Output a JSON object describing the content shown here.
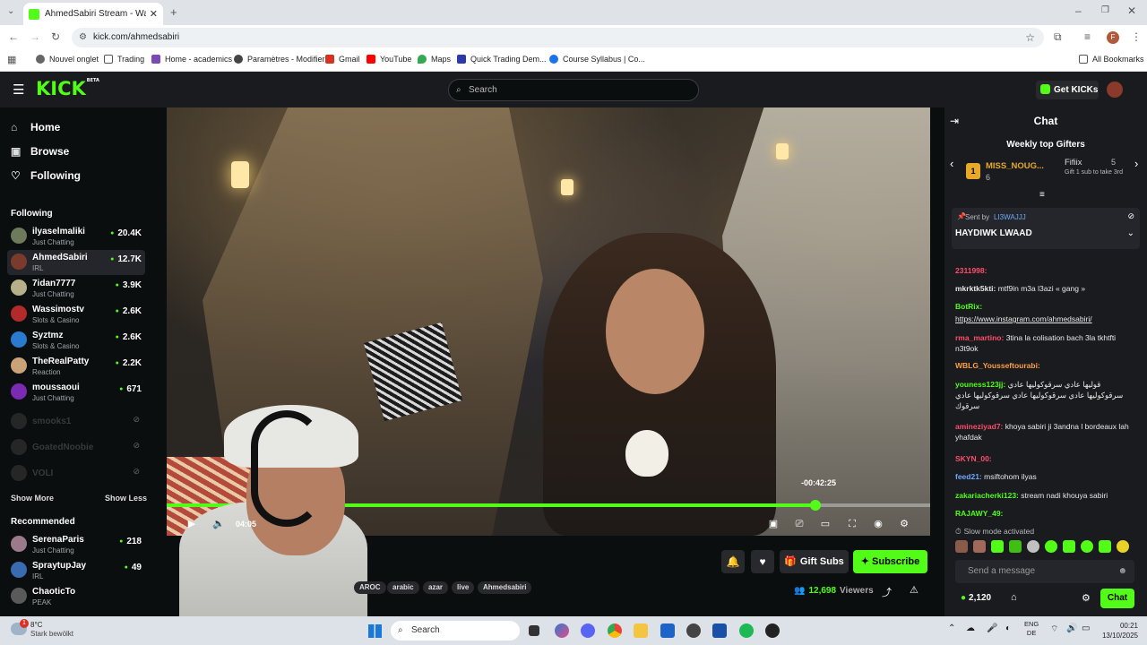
{
  "browser": {
    "tab_title": "AhmedSabiri Stream - Watch Li",
    "url": "kick.com/ahmedsabiri",
    "bookmarks": [
      "Nouvel onglet",
      "Trading",
      "Home - academics",
      "Paramètres - Modifier",
      "Gmail",
      "YouTube",
      "Maps",
      "Quick Trading Dem...",
      "Course Syllabus | Co..."
    ],
    "all_bookmarks": "All Bookmarks",
    "profile_initial": "F"
  },
  "header": {
    "logo": "KICK",
    "logo_beta": "BETA",
    "search_placeholder": "Search",
    "get_kicks": "Get KICKs"
  },
  "sidebar": {
    "nav": [
      {
        "label": "Home",
        "icon": "home-icon"
      },
      {
        "label": "Browse",
        "icon": "browse-icon"
      },
      {
        "label": "Following",
        "icon": "heart-icon"
      }
    ],
    "following_title": "Following",
    "following": [
      {
        "name": "ilyaselmaliki",
        "category": "Just Chatting",
        "viewers": "20.4K"
      },
      {
        "name": "AhmedSabiri",
        "category": "IRL",
        "viewers": "12.7K"
      },
      {
        "name": "7idan7777",
        "category": "Just Chatting",
        "viewers": "3.9K"
      },
      {
        "name": "Wassimostv",
        "category": "Slots & Casino",
        "viewers": "2.6K"
      },
      {
        "name": "Syztmz",
        "category": "Slots & Casino",
        "viewers": "2.6K"
      },
      {
        "name": "TheRealPatty",
        "category": "Reaction",
        "viewers": "2.2K"
      },
      {
        "name": "moussaoui",
        "category": "Just Chatting",
        "viewers": "671"
      }
    ],
    "offline": [
      "smooks1",
      "GoatedNoobie",
      "VOLI"
    ],
    "show_more": "Show More",
    "show_less": "Show Less",
    "recommended_title": "Recommended",
    "recommended": [
      {
        "name": "SerenaParis",
        "category": "Just Chatting",
        "viewers": "218"
      },
      {
        "name": "SpraytupJay",
        "category": "IRL",
        "viewers": "49"
      },
      {
        "name": "ChaoticTo",
        "category": "PEAK",
        "viewers": ""
      }
    ]
  },
  "player": {
    "time_left": "-00:42:25",
    "time_current": "04:05",
    "progress": 0.85
  },
  "below": {
    "gift_subs": "Gift Subs",
    "subscribe": "Subscribe",
    "tags": [
      "AROC",
      "arabic",
      "azar",
      "live",
      "Ahmedsabiri"
    ],
    "viewers_count": "12,698",
    "viewers_label": "Viewers"
  },
  "chat": {
    "title": "Chat",
    "weekly_top_gifters": "Weekly top Gifters",
    "gifter1": {
      "rank": "1",
      "name": "MISS_NOUG...",
      "count": "6"
    },
    "gifter2": {
      "name": "Fifiix",
      "count": "5",
      "note": "Gift 1 sub to take 3rd"
    },
    "pinned_sent_by_label": "Sent by",
    "pinned_sent_by": "LI3WAJJJ",
    "pinned_text": "HAYDIWK LWAAD",
    "messages": [
      {
        "user": "2311998:",
        "color": "#ff4d6a",
        "text": ""
      },
      {
        "user": "mkrktk5kti:",
        "color": "#e8e8e8",
        "text": "mtf9in m3a l3azi « gang »"
      },
      {
        "user": "BotRix:",
        "color": "#53fc18",
        "text": ""
      },
      {
        "user": "",
        "color": "#e8e8e8",
        "text": "https://www.instagram.com/ahmedsabiri/"
      },
      {
        "user": "rma_martino:",
        "color": "#ff4d6a",
        "text": "3tina la colisation bach 3la tkhtfti n3t9ok"
      },
      {
        "user": "WBLG_Yousseftourabi:",
        "color": "#ff9f43",
        "text": ""
      },
      {
        "user": "youness123jj:",
        "color": "#53fc18",
        "text": "قوليها عادي سرقوكوليها عادي سرقوكوليها عادي سرقوكوليها عادي سرقوكوليها عادي سرقوك"
      },
      {
        "user": "amineziyad7:",
        "color": "#ff4d6a",
        "text": "khoya sabiri ji 3andna l bordeaux lah yhafdak"
      },
      {
        "user": "SKYN_00:",
        "color": "#ff4d6a",
        "text": ""
      },
      {
        "user": "feed21:",
        "color": "#6ea8ff",
        "text": "msiftohom ilyas"
      },
      {
        "user": "zakariacherki123:",
        "color": "#53fc18",
        "text": "stream nadi khouya sabiri"
      },
      {
        "user": "RAJAWY_49:",
        "color": "#53fc18",
        "text": ""
      }
    ],
    "slow_mode": "Slow mode activated",
    "send_placeholder": "Send a message",
    "kicks_count": "2,120",
    "chat_button": "Chat"
  },
  "taskbar": {
    "weather_temp": "8°C",
    "weather_desc": "Stark bewölkt",
    "search": "Search",
    "lang": "ENG",
    "lang2": "DE",
    "time": "00:21",
    "date": "13/10/2025",
    "notif": "1"
  }
}
